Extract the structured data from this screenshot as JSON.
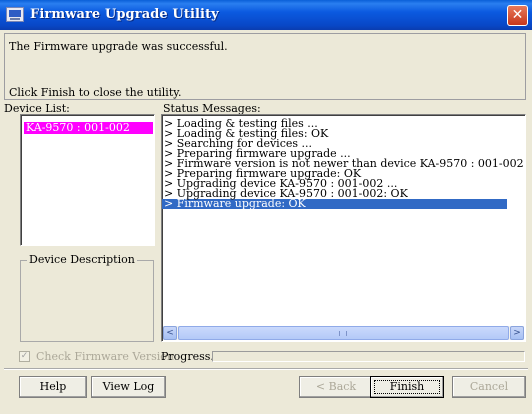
{
  "window": {
    "title": "Firmware Upgrade Utility",
    "close_glyph": "✕"
  },
  "message": {
    "line1": "The Firmware upgrade was successful.",
    "line2": "Click Finish to close the utility."
  },
  "device_list": {
    "label": "Device List:",
    "items": [
      "KA-9570 : 001-002"
    ],
    "selected_color": "#ff00ff"
  },
  "device_description": {
    "label": "Device Description"
  },
  "status": {
    "label": "Status Messages:",
    "lines": [
      "> Loading & testing files ...",
      "> Loading & testing files: OK",
      "> Searching for devices ...",
      "> Preparing firmware upgrade ...",
      "> Firmware version is not newer than device KA-9570 : 001-002",
      "> Preparing firmware upgrade: OK",
      "> Upgrading device KA-9570 : 001-002 ...",
      "> Upgrading device KA-9570 : 001-002: OK",
      "> Firmware upgrade: OK"
    ],
    "selected_index": 8,
    "scroll_left_glyph": "<",
    "scroll_right_glyph": ">"
  },
  "options": {
    "check_firmware_label": "Check Firmware Version",
    "check_firmware_checked": true,
    "check_glyph": "✓",
    "progress_label": "Progress...",
    "progress_value": 0
  },
  "buttons": {
    "help": "Help",
    "view_log": "View Log",
    "back": "< Back",
    "finish": "Finish",
    "cancel": "Cancel"
  },
  "colors": {
    "titlebar": "#0a5fd8",
    "selection": "#316ac5"
  }
}
